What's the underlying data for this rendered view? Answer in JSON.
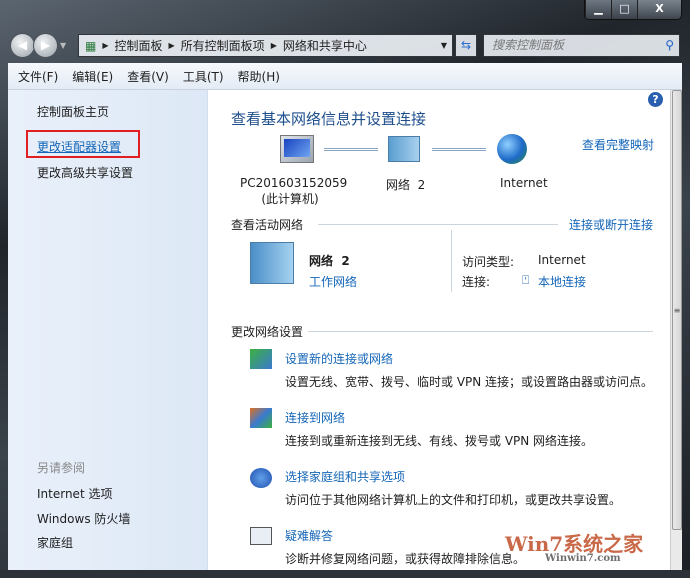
{
  "window": {
    "minimize": "▁",
    "maximize": "□",
    "close": "X"
  },
  "address": {
    "crumbs": [
      "控制面板",
      "所有控制面板项",
      "网络和共享中心"
    ],
    "search_placeholder": "搜索控制面板"
  },
  "menu": [
    "文件(F)",
    "编辑(E)",
    "查看(V)",
    "工具(T)",
    "帮助(H)"
  ],
  "sidebar": {
    "items": [
      "控制面板主页",
      "更改适配器设置",
      "更改高级共享设置"
    ],
    "see_also_title": "另请参阅",
    "see_also": [
      "Internet 选项",
      "Windows 防火墙",
      "家庭组"
    ]
  },
  "main": {
    "title": "查看基本网络信息并设置连接",
    "full_map": "查看完整映射",
    "map": {
      "computer": "PC201603152059",
      "computer_sub": "(此计算机)",
      "network": "网络  2",
      "internet": "Internet"
    },
    "active_title": "查看活动网络",
    "connect_disconnect": "连接或断开连接",
    "active": {
      "name": "网络  2",
      "type": "工作网络",
      "access_label": "访问类型:",
      "access_value": "Internet",
      "conn_label": "连接:",
      "conn_value": "本地连接"
    },
    "change_title": "更改网络设置",
    "tasks": [
      {
        "title": "设置新的连接或网络",
        "desc": "设置无线、宽带、拨号、临时或 VPN 连接；或设置路由器或访问点。"
      },
      {
        "title": "连接到网络",
        "desc": "连接到或重新连接到无线、有线、拨号或 VPN 网络连接。"
      },
      {
        "title": "选择家庭组和共享选项",
        "desc": "访问位于其他网络计算机上的文件和打印机，或更改共享设置。"
      },
      {
        "title": "疑难解答",
        "desc": "诊断并修复网络问题，或获得故障排除信息。"
      }
    ]
  },
  "watermark": {
    "brand": "Win7系统之家",
    "url": "Winwin7.com"
  }
}
